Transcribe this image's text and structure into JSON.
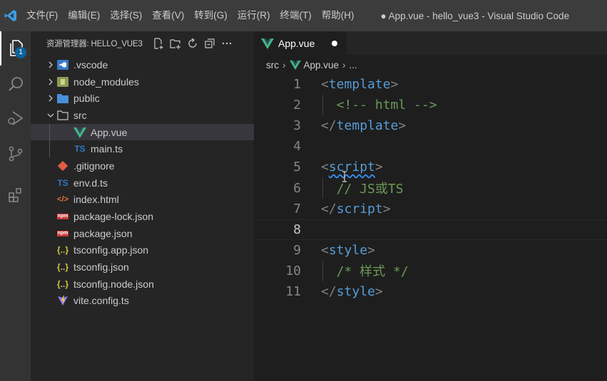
{
  "menu": [
    "文件(F)",
    "编辑(E)",
    "选择(S)",
    "查看(V)",
    "转到(G)",
    "运行(R)",
    "终端(T)",
    "帮助(H)"
  ],
  "window_title": "● App.vue - hello_vue3 - Visual Studio Code",
  "activity": {
    "explorer_badge": "1"
  },
  "explorer": {
    "title": "资源管理器: HELLO_VUE3",
    "items": [
      {
        "name": ".vscode",
        "type": "folder-vscode",
        "depth": 1,
        "chevron": "right"
      },
      {
        "name": "node_modules",
        "type": "folder-node",
        "depth": 1,
        "chevron": "right"
      },
      {
        "name": "public",
        "type": "folder",
        "depth": 1,
        "chevron": "right"
      },
      {
        "name": "src",
        "type": "folder-open",
        "depth": 1,
        "chevron": "down"
      },
      {
        "name": "App.vue",
        "type": "vue",
        "depth": 2,
        "selected": true
      },
      {
        "name": "main.ts",
        "type": "ts",
        "depth": 2
      },
      {
        "name": ".gitignore",
        "type": "git",
        "depth": 1
      },
      {
        "name": "env.d.ts",
        "type": "ts",
        "depth": 1
      },
      {
        "name": "index.html",
        "type": "html",
        "depth": 1
      },
      {
        "name": "package-lock.json",
        "type": "npm",
        "depth": 1
      },
      {
        "name": "package.json",
        "type": "npm",
        "depth": 1
      },
      {
        "name": "tsconfig.app.json",
        "type": "json",
        "depth": 1
      },
      {
        "name": "tsconfig.json",
        "type": "json",
        "depth": 1
      },
      {
        "name": "tsconfig.node.json",
        "type": "json",
        "depth": 1
      },
      {
        "name": "vite.config.ts",
        "type": "vite",
        "depth": 1
      }
    ]
  },
  "editor": {
    "tab_label": "App.vue",
    "breadcrumb": [
      "src",
      "App.vue",
      "..."
    ],
    "lines": [
      {
        "n": "1",
        "tokens": [
          [
            "br",
            "<"
          ],
          [
            "tag",
            "template"
          ],
          [
            "br",
            ">"
          ]
        ]
      },
      {
        "n": "2",
        "tokens": [
          [
            "cm",
            "  <!-- html -->"
          ]
        ]
      },
      {
        "n": "3",
        "tokens": [
          [
            "br",
            "</"
          ],
          [
            "tag",
            "template"
          ],
          [
            "br",
            ">"
          ]
        ]
      },
      {
        "n": "4",
        "tokens": []
      },
      {
        "n": "5",
        "tokens": [
          [
            "br",
            "<"
          ],
          [
            "tag squig",
            "script"
          ],
          [
            "br",
            ">"
          ]
        ]
      },
      {
        "n": "6",
        "tokens": [
          [
            "cm",
            "  // JS或TS"
          ]
        ]
      },
      {
        "n": "7",
        "tokens": [
          [
            "br",
            "</"
          ],
          [
            "tag",
            "script"
          ],
          [
            "br",
            ">"
          ]
        ]
      },
      {
        "n": "8",
        "tokens": [],
        "active": true
      },
      {
        "n": "9",
        "tokens": [
          [
            "br",
            "<"
          ],
          [
            "tag",
            "style"
          ],
          [
            "br",
            ">"
          ]
        ]
      },
      {
        "n": "10",
        "tokens": [
          [
            "cm",
            "  /* 样式 */"
          ]
        ]
      },
      {
        "n": "11",
        "tokens": [
          [
            "br",
            "</"
          ],
          [
            "tag",
            "style"
          ],
          [
            "br",
            ">"
          ]
        ]
      }
    ]
  },
  "colors": {
    "accent": "#0e639c",
    "vue": "#41b883",
    "ts": "#3178c6",
    "tag": "#569cd6",
    "comment": "#6a9955"
  }
}
